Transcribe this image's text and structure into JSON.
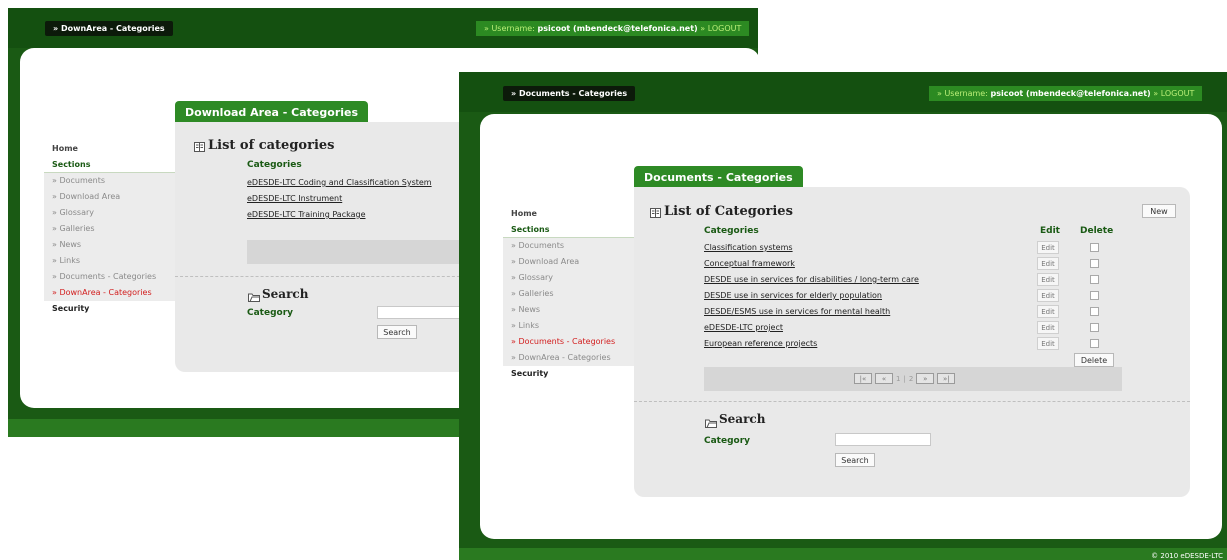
{
  "back_window": {
    "breadcrumb": "» DownArea - Categories",
    "user": {
      "label": "» Username:",
      "name": "psicoot (mbendeck@telefonica.net)",
      "logout": "» LOGOUT"
    },
    "sidebar": {
      "home": "Home",
      "sections": "Sections",
      "items": [
        "» Documents",
        "» Download Area",
        "» Glossary",
        "» Galleries",
        "» News",
        "» Links",
        "» Documents - Categories",
        "» DownArea - Categories"
      ],
      "security": "Security"
    },
    "tab": "Download Area - Categories",
    "list_title": "List of categories",
    "column_header": "Categories",
    "categories": [
      "eDESDE-LTC Coding and Classification System",
      "eDESDE-LTC Instrument",
      "eDESDE-LTC Training Package"
    ],
    "search_title": "Search",
    "search_label": "Category",
    "search_button": "Search"
  },
  "front_window": {
    "breadcrumb": "» Documents - Categories",
    "user": {
      "label": "» Username:",
      "name": "psicoot (mbendeck@telefonica.net)",
      "logout": "» LOGOUT"
    },
    "sidebar": {
      "home": "Home",
      "sections": "Sections",
      "items": [
        "» Documents",
        "» Download Area",
        "» Glossary",
        "» Galleries",
        "» News",
        "» Links",
        "» Documents - Categories",
        "» DownArea - Categories"
      ],
      "security": "Security"
    },
    "tab": "Documents - Categories",
    "list_title": "List of Categories",
    "new_button": "New",
    "columns": {
      "category": "Categories",
      "edit": "Edit",
      "delete": "Delete"
    },
    "rows": [
      {
        "name": "Classification systems",
        "edit": "Edit"
      },
      {
        "name": "Conceptual framework",
        "edit": "Edit"
      },
      {
        "name": "DESDE use in services for disabilities / long-term care",
        "edit": "Edit"
      },
      {
        "name": "DESDE use in services for elderly population",
        "edit": "Edit"
      },
      {
        "name": "DESDE/ESMS use in services for mental health",
        "edit": "Edit"
      },
      {
        "name": "eDESDE-LTC project",
        "edit": "Edit"
      },
      {
        "name": "European reference projects",
        "edit": "Edit"
      }
    ],
    "delete_button": "Delete",
    "pager": {
      "first": "|«",
      "prev": "«",
      "pages": [
        "1",
        "2"
      ],
      "next": "»",
      "last": "»|"
    },
    "search_title": "Search",
    "search_label": "Category",
    "search_button": "Search",
    "copyright": "© 2010 eDESDE-LTC"
  },
  "colors": {
    "frame_green": "#1a5a14",
    "tab_green": "#2e8a25",
    "active_red": "#d21e1e",
    "content_gray": "#e9e9e9"
  }
}
